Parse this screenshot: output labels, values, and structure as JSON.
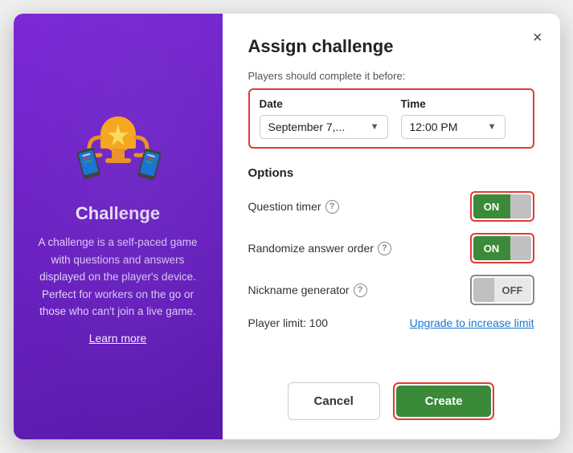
{
  "left": {
    "title": "Challenge",
    "description": "A challenge is a self-paced game with questions and answers displayed on the player's device. Perfect for workers on the go or those who can't join a live game.",
    "learn_more": "Learn more"
  },
  "right": {
    "title": "Assign challenge",
    "close_label": "×",
    "deadline_label": "Players should complete it before:",
    "date_header": "Date",
    "time_header": "Time",
    "date_value": "September 7,...",
    "time_value": "12:00 PM",
    "options_title": "Options",
    "options": [
      {
        "label": "Question timer",
        "state": "ON"
      },
      {
        "label": "Randomize answer order",
        "state": "ON"
      },
      {
        "label": "Nickname generator",
        "state": "OFF"
      }
    ],
    "player_limit_label": "Player limit: 100",
    "upgrade_link": "Upgrade to increase limit",
    "cancel_label": "Cancel",
    "create_label": "Create"
  }
}
